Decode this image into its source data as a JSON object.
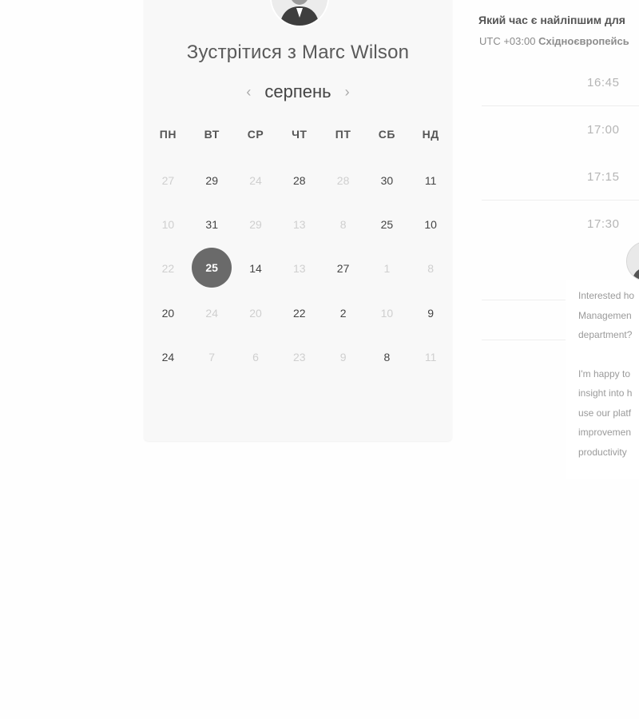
{
  "scheduler": {
    "host_avatar": "host-photo",
    "title": "Зустрітися з Marc Wilson",
    "month": "серпень",
    "prev_icon": "‹",
    "next_icon": "›",
    "weekdays": [
      "ПН",
      "ВТ",
      "СР",
      "ЧТ",
      "ПТ",
      "СБ",
      "НД"
    ],
    "weeks": [
      [
        {
          "d": "27",
          "muted": true
        },
        {
          "d": "29",
          "muted": false
        },
        {
          "d": "24",
          "muted": true
        },
        {
          "d": "28",
          "muted": false
        },
        {
          "d": "28",
          "muted": true
        },
        {
          "d": "30",
          "muted": false
        },
        {
          "d": "11",
          "muted": false
        }
      ],
      [
        {
          "d": "10",
          "muted": true
        },
        {
          "d": "31",
          "muted": false
        },
        {
          "d": "29",
          "muted": true
        },
        {
          "d": "13",
          "muted": true
        },
        {
          "d": "8",
          "muted": true
        },
        {
          "d": "25",
          "muted": false
        },
        {
          "d": "10",
          "muted": false
        }
      ],
      [
        {
          "d": "22",
          "muted": true
        },
        {
          "d": "25",
          "muted": false,
          "selected": true
        },
        {
          "d": "14",
          "muted": false
        },
        {
          "d": "13",
          "muted": true
        },
        {
          "d": "27",
          "muted": false
        },
        {
          "d": "1",
          "muted": true
        },
        {
          "d": "8",
          "muted": true
        }
      ],
      [
        {
          "d": "20",
          "muted": false
        },
        {
          "d": "24",
          "muted": true
        },
        {
          "d": "20",
          "muted": true
        },
        {
          "d": "22",
          "muted": false
        },
        {
          "d": "2",
          "muted": false
        },
        {
          "d": "10",
          "muted": true
        },
        {
          "d": "9",
          "muted": false
        }
      ],
      [
        {
          "d": "24",
          "muted": false
        },
        {
          "d": "7",
          "muted": true
        },
        {
          "d": "6",
          "muted": true
        },
        {
          "d": "23",
          "muted": true
        },
        {
          "d": "9",
          "muted": true
        },
        {
          "d": "8",
          "muted": false
        },
        {
          "d": "11",
          "muted": true
        }
      ]
    ]
  },
  "times": {
    "question": "Який час є найліпшим для",
    "utc": "UTC +03:00",
    "tz_name": "Східноєвропейсь",
    "slots": [
      "16:45",
      "17:00",
      "17:15",
      "17:30"
    ]
  },
  "chat": {
    "avatar": "agent-photo",
    "message1": [
      "Interested ho",
      "Managemen",
      "department?"
    ],
    "message2": [
      "I'm happy to",
      "insight into h",
      "use our platf",
      "improvemen",
      "productivity"
    ]
  }
}
